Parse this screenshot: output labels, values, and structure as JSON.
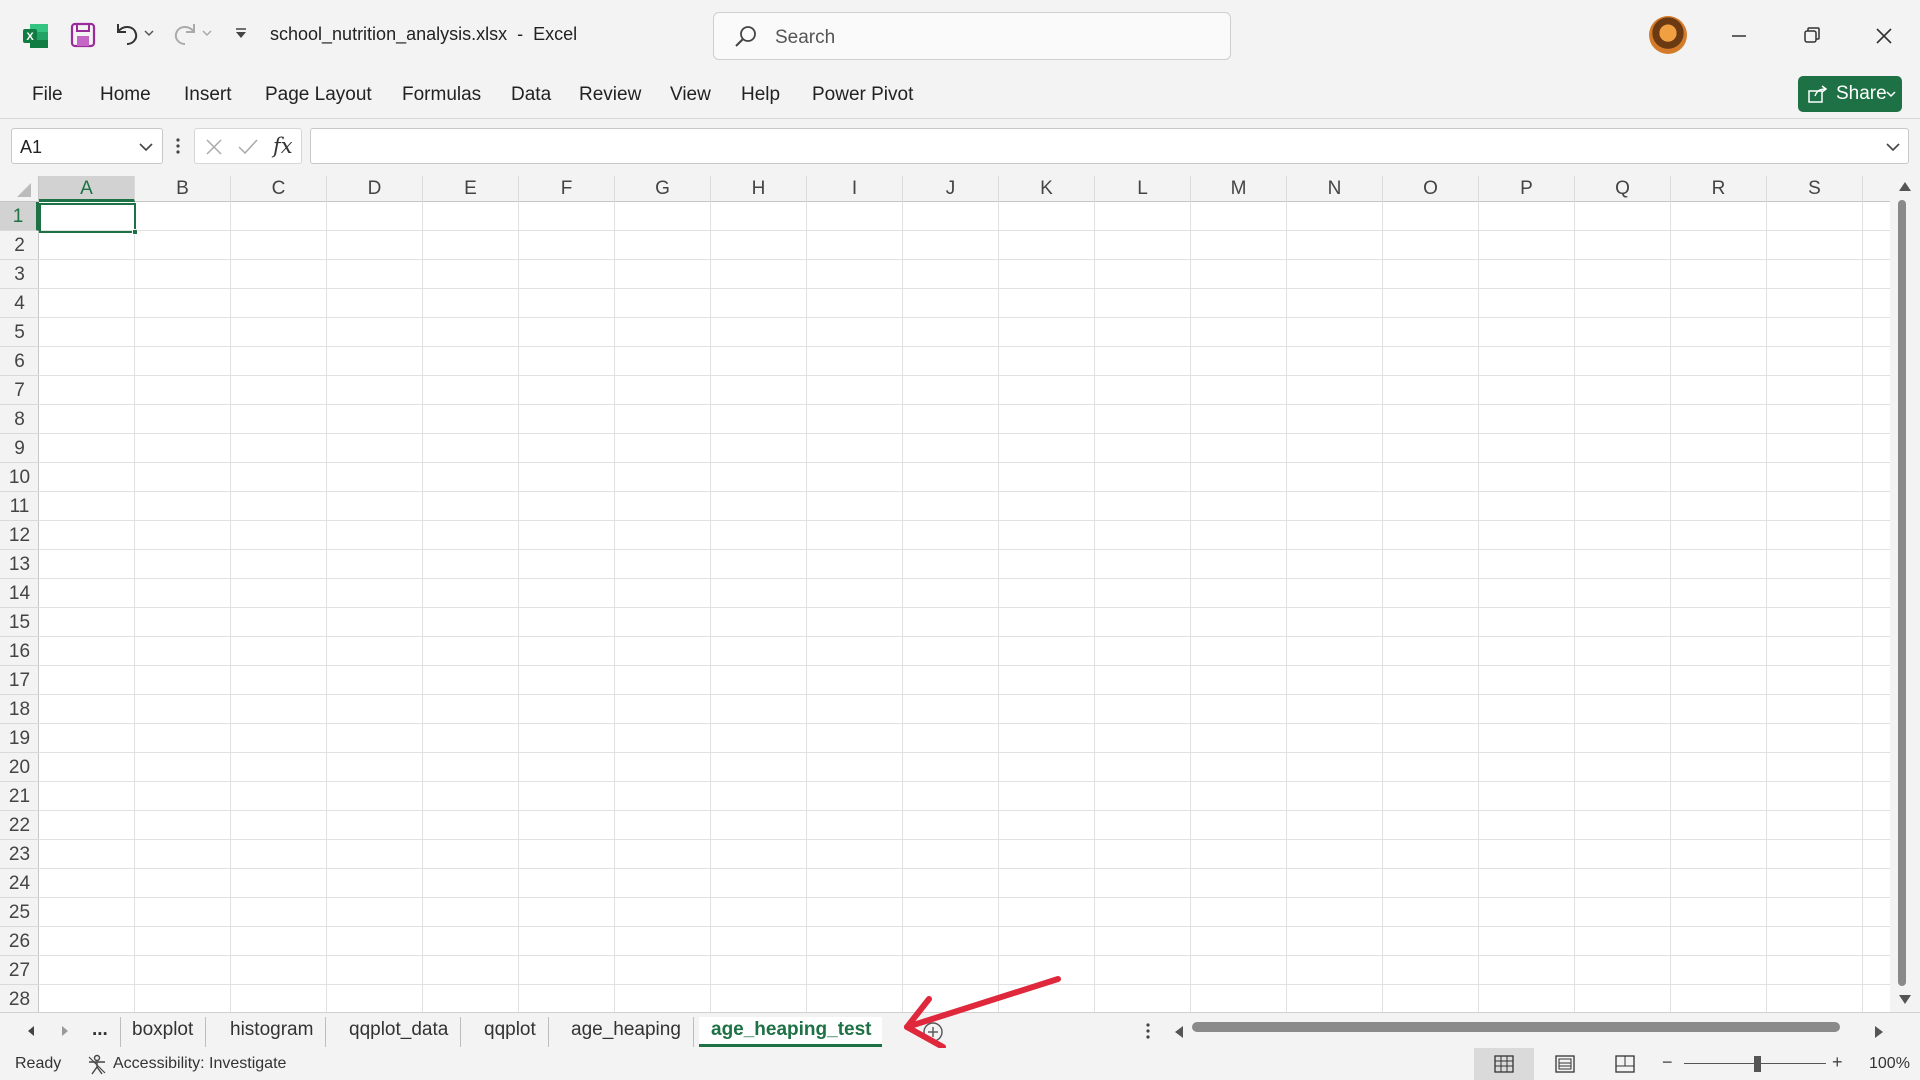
{
  "window": {
    "file_name": "school_nutrition_analysis.xlsx",
    "separator": "-",
    "app_name": "Excel",
    "search_placeholder": "Search"
  },
  "ribbon": {
    "tabs": [
      "File",
      "Home",
      "Insert",
      "Page Layout",
      "Formulas",
      "Data",
      "Review",
      "View",
      "Help",
      "Power Pivot"
    ],
    "share_label": "Share"
  },
  "formula_bar": {
    "name_box": "A1",
    "formula_value": "",
    "fx_label": "fx"
  },
  "grid": {
    "columns": [
      "A",
      "B",
      "C",
      "D",
      "E",
      "F",
      "G",
      "H",
      "I",
      "J",
      "K",
      "L",
      "M",
      "N",
      "O",
      "P",
      "Q",
      "R",
      "S"
    ],
    "rows": [
      "1",
      "2",
      "3",
      "4",
      "5",
      "6",
      "7",
      "8",
      "9",
      "10",
      "11",
      "12",
      "13",
      "14",
      "15",
      "16",
      "17",
      "18",
      "19",
      "20",
      "21",
      "22",
      "23",
      "24",
      "25",
      "26",
      "27",
      "28"
    ],
    "selected_cell": "A1"
  },
  "sheets": {
    "overflow_label": "...",
    "tabs": [
      "boxplot",
      "histogram",
      "qqplot_data",
      "qqplot",
      "age_heaping",
      "age_heaping_test"
    ],
    "active": "age_heaping_test"
  },
  "status": {
    "mode": "Ready",
    "accessibility": "Accessibility: Investigate",
    "zoom": "100%"
  },
  "colors": {
    "accent": "#1e7145",
    "annotation_arrow": "#e0283c"
  },
  "icons": [
    "excel-logo-icon",
    "save-icon",
    "undo-icon",
    "redo-icon",
    "customize-quick-access-icon",
    "search-icon",
    "minimize-icon",
    "restore-icon",
    "close-icon",
    "share-icon",
    "cancel-icon",
    "enter-icon",
    "name-box-dropdown-icon",
    "formula-expand-icon",
    "add-sheet-icon",
    "accessibility-icon",
    "normal-view-icon",
    "page-layout-view-icon",
    "page-break-view-icon"
  ]
}
